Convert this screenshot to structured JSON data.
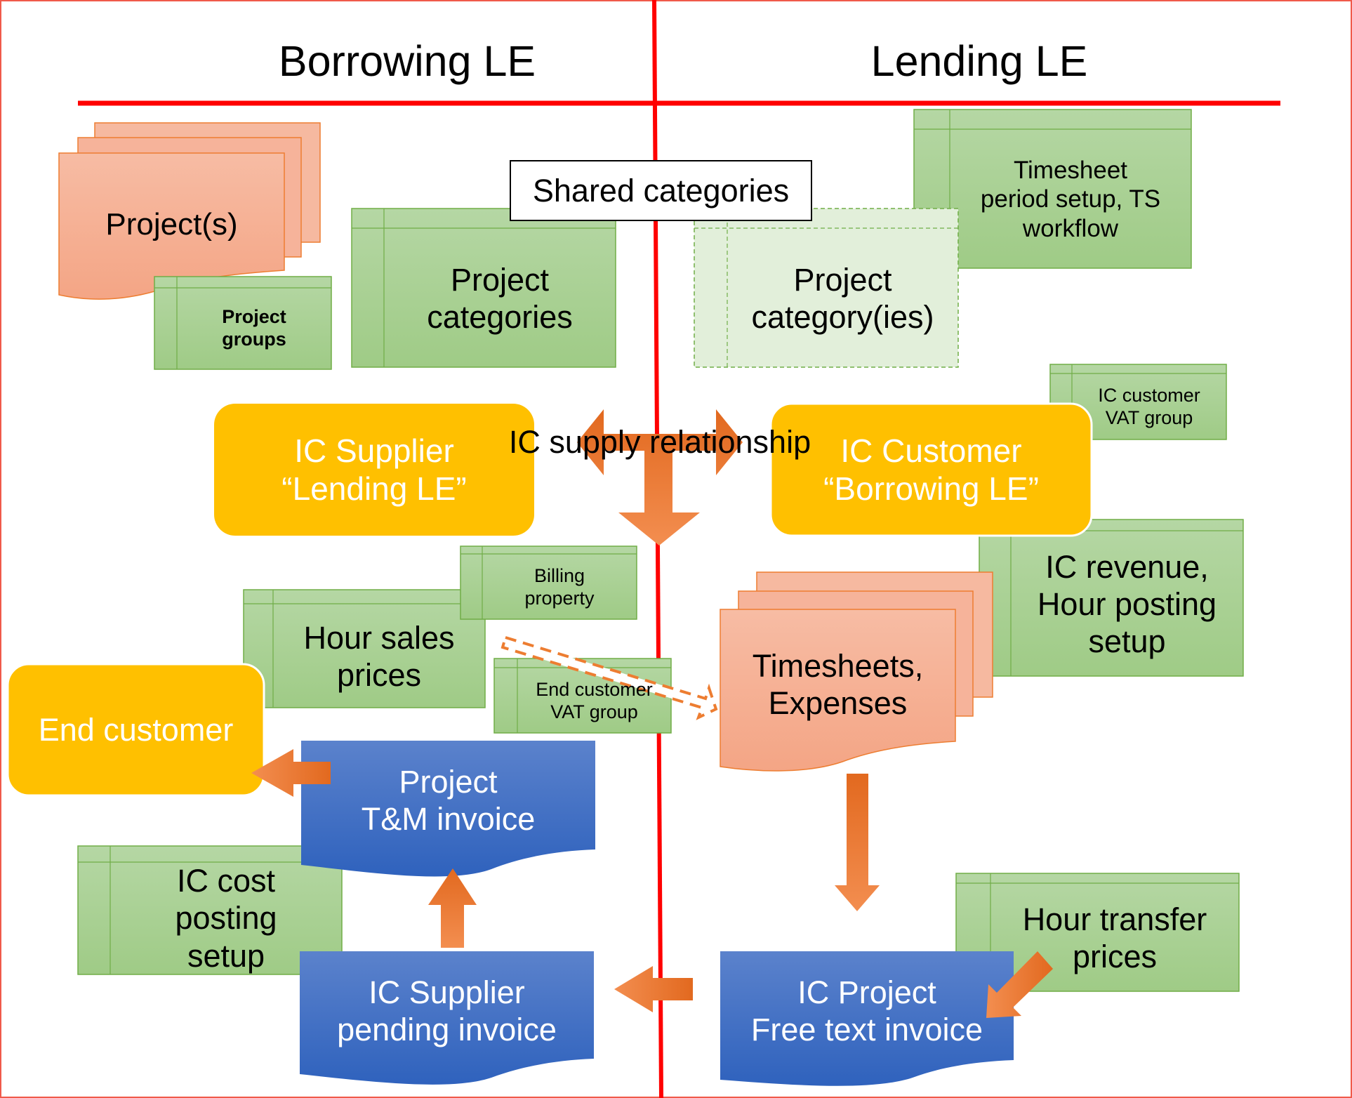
{
  "headers": {
    "left": "Borrowing LE",
    "right": "Lending LE"
  },
  "shared_categories_label": "Shared categories",
  "ic_supply_relationship_label": "IC supply relationship",
  "nodes": {
    "projects": "Project(s)",
    "project_groups": "Project\ngroups",
    "project_categories": "Project\ncategories",
    "project_categories_lending": "Project\ncategory(ies)",
    "timesheet_setup": "Timesheet\nperiod setup, TS\nworkflow",
    "ic_customer_vat_group": "IC customer\nVAT group",
    "ic_supplier": "IC Supplier\n“Lending LE”",
    "ic_customer": "IC Customer\n“Borrowing LE”",
    "billing_property": "Billing\nproperty",
    "hour_sales_prices": "Hour sales\nprices",
    "end_customer_vat_group": "End customer\nVAT group",
    "end_customer": "End customer",
    "project_tm_invoice": "Project\nT&M invoice",
    "ic_cost_posting_setup": "IC cost\nposting\nsetup",
    "ic_supplier_pending_invoice": "IC Supplier\npending invoice",
    "timesheets_expenses": "Timesheets,\nExpenses",
    "ic_revenue_setup": "IC revenue,\nHour posting\nsetup",
    "hour_transfer_prices": "Hour transfer\nprices",
    "ic_project_free_text_invoice": "IC Project\nFree text invoice"
  },
  "colors": {
    "divider_red": "#ff0000",
    "frame_red": "#f05a4a",
    "table_green": "#a9d18e",
    "table_green_light": "#e2efda",
    "table_border": "#70ad47",
    "doc_salmon": "#f4b183",
    "doc_border": "#ed7d31",
    "entity_yellow": "#ffc000",
    "invoice_blue": "#4472c4",
    "arrow_orange": "#ed7d31"
  }
}
